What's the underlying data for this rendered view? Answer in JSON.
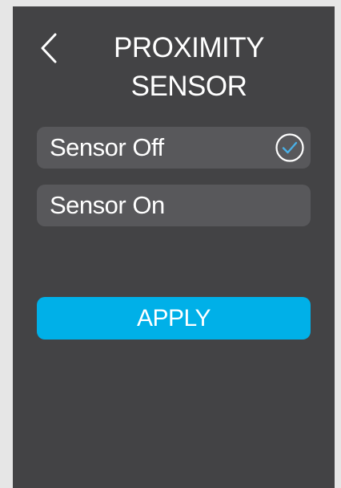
{
  "header": {
    "title_line1": "PROXIMITY",
    "title_line2": "SENSOR",
    "back_icon": "chevron-left-icon"
  },
  "options": [
    {
      "label": "Sensor Off",
      "selected": true
    },
    {
      "label": "Sensor On",
      "selected": false
    }
  ],
  "apply_label": "APPLY",
  "colors": {
    "background": "#434345",
    "option_bg": "#58585b",
    "accent": "#00b0e8",
    "check": "#4ab0e6"
  }
}
